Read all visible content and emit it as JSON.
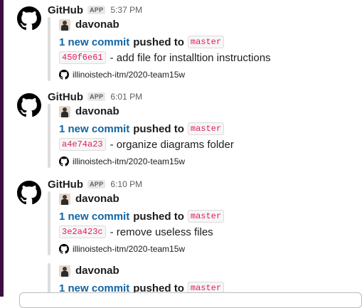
{
  "messages": [
    {
      "sender": "GitHub",
      "badge": "APP",
      "time": "5:37 PM",
      "author": "davonab",
      "commit_link": "1 new commit",
      "pushed_to": "pushed to",
      "branch": "master",
      "hash": "450f6e61",
      "commit_message": "- add file for installtion instructions",
      "repo": "illinoistech-itm/2020-team15w"
    },
    {
      "sender": "GitHub",
      "badge": "APP",
      "time": "6:01 PM",
      "author": "davonab",
      "commit_link": "1 new commit",
      "pushed_to": "pushed to",
      "branch": "master",
      "hash": "a4e74a23",
      "commit_message": "- organize diagrams folder",
      "repo": "illinoistech-itm/2020-team15w"
    },
    {
      "sender": "GitHub",
      "badge": "APP",
      "time": "6:10 PM",
      "author": "davonab",
      "commit_link": "1 new commit",
      "pushed_to": "pushed to",
      "branch": "master",
      "hash": "3e2a423c",
      "commit_message": "- remove useless files",
      "repo": "illinoistech-itm/2020-team15w"
    }
  ],
  "partial": {
    "author": "davonab",
    "commit_link": "1 new commit",
    "pushed_to": "pushed to",
    "branch": "master"
  },
  "colors": {
    "link": "#1264a3",
    "code_text": "#e01e5a",
    "sidebar": "#3f0e40"
  },
  "icons": [
    "github-logo-icon",
    "github-small-icon",
    "user-avatar"
  ]
}
